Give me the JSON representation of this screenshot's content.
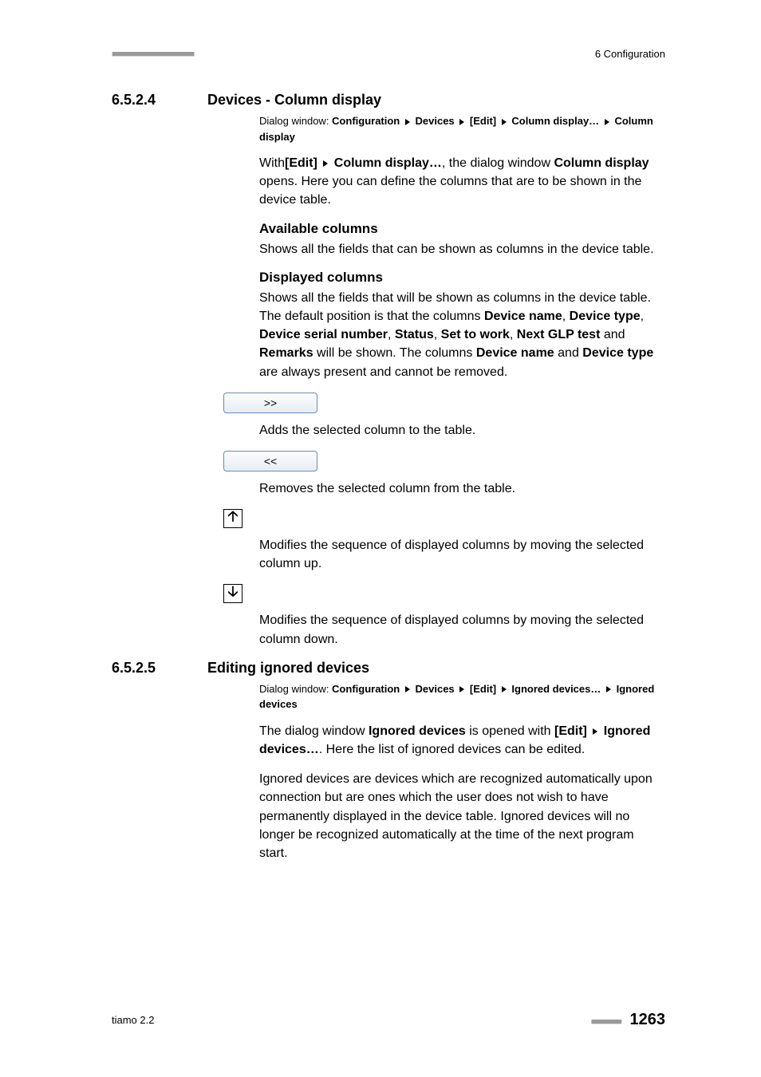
{
  "header": {
    "dots": "■■■■■■■■■■■■■■■■■■■■■■",
    "chapter": "6 Configuration"
  },
  "section1": {
    "num": "6.5.2.4",
    "title": "Devices - Column display",
    "dialog_prefix": "Dialog window: ",
    "path": [
      "Configuration",
      "Devices",
      "[Edit]",
      "Column display…",
      "Column display"
    ],
    "intro_spans": [
      "With",
      "[Edit]",
      "Column display…",
      ", the dialog window ",
      "Column display",
      " opens. Here you can define the columns that are to be shown in the device table."
    ],
    "available_head": "Available columns",
    "available_text": "Shows all the fields that can be shown as columns in the device table.",
    "displayed_head": "Displayed columns",
    "displayed_spans": [
      "Shows all the fields that will be shown as columns in the device table. The default position is that the columns ",
      "Device name",
      ", ",
      "Device type",
      ", ",
      "Device serial number",
      ", ",
      "Status",
      ", ",
      "Set to work",
      ", ",
      "Next GLP test",
      " and ",
      "Remarks",
      " will be shown. The columns ",
      "Device name",
      " and ",
      "Device type",
      " are always present and cannot be removed."
    ],
    "btn_add": ">>",
    "btn_add_desc": "Adds the selected column to the table.",
    "btn_remove": "<<",
    "btn_remove_desc": "Removes the selected column from the table.",
    "up_desc": "Modifies the sequence of displayed columns by moving the selected column up.",
    "down_desc": "Modifies the sequence of displayed columns by moving the selected column down."
  },
  "section2": {
    "num": "6.5.2.5",
    "title": "Editing ignored devices",
    "dialog_prefix": "Dialog window: ",
    "path": [
      "Configuration",
      "Devices",
      "[Edit]",
      "Ignored devices…",
      "Ignored devices"
    ],
    "p1_spans": [
      "The dialog window ",
      "Ignored devices",
      " is opened with ",
      "[Edit]",
      "Ignored devices…",
      ". Here the list of ignored devices can be edited."
    ],
    "p2": "Ignored devices are devices which are recognized automatically upon connection but are ones which the user does not wish to have permanently displayed in the device table. Ignored devices will no longer be recognized automatically at the time of the next program start."
  },
  "footer": {
    "product": "tiamo 2.2",
    "dots": "■■■■■■■■",
    "page": "1263"
  }
}
